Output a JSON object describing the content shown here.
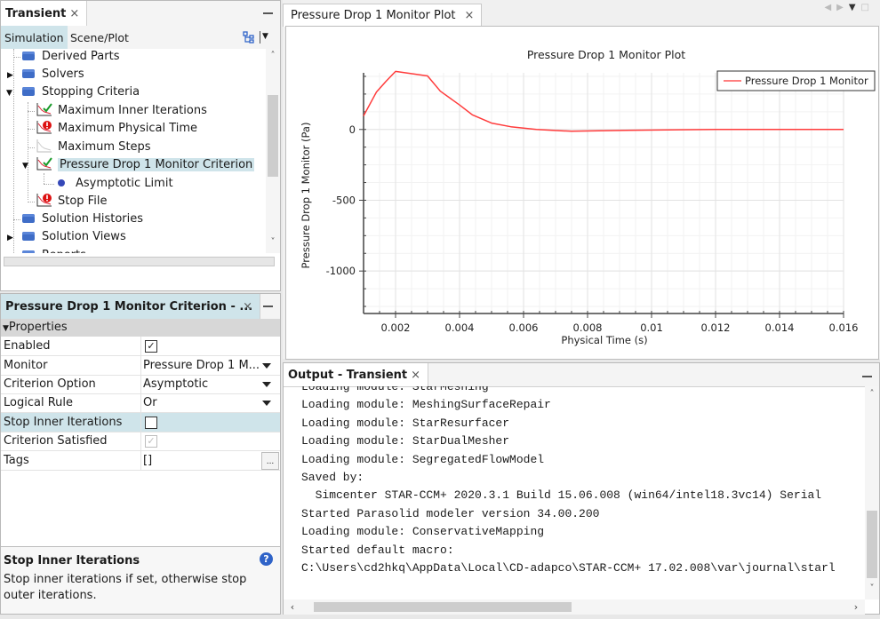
{
  "tree_panel": {
    "tab_label": "Transient",
    "subtabs": [
      "Simulation",
      "Scene/Plot"
    ],
    "items": [
      {
        "label": "Derived Parts",
        "icon": "folder-icon",
        "expander": ""
      },
      {
        "label": "Solvers",
        "icon": "folder-icon",
        "expander": "collapsed"
      },
      {
        "label": "Stopping Criteria",
        "icon": "folder-icon",
        "expander": "expanded"
      },
      {
        "label": "Maximum Inner Iterations",
        "icon": "criterion-satisfied-icon"
      },
      {
        "label": "Maximum Physical Time",
        "icon": "criterion-error-icon"
      },
      {
        "label": "Maximum Steps",
        "icon": "criterion-disabled-icon"
      },
      {
        "label": "Pressure Drop 1 Monitor Criterion",
        "icon": "criterion-satisfied-icon",
        "expander": "expanded",
        "selected": true
      },
      {
        "label": "Asymptotic Limit",
        "icon": "dot-icon"
      },
      {
        "label": "Stop File",
        "icon": "criterion-error-icon"
      },
      {
        "label": "Solution Histories",
        "icon": "folder-icon"
      },
      {
        "label": "Solution Views",
        "icon": "folder-icon",
        "expander": "collapsed"
      },
      {
        "label": "Reports",
        "icon": "folder-icon"
      }
    ]
  },
  "prop_panel": {
    "tab_label": "Pressure Drop 1 Monitor Criterion - ...",
    "section": "Properties",
    "rows": [
      {
        "name": "Enabled",
        "value": "",
        "type": "checkbox",
        "checked": true
      },
      {
        "name": "Monitor",
        "value": "Pressure Drop 1 M...",
        "type": "dropdown"
      },
      {
        "name": "Criterion Option",
        "value": "Asymptotic",
        "type": "dropdown"
      },
      {
        "name": "Logical Rule",
        "value": "Or",
        "type": "dropdown"
      },
      {
        "name": "Stop Inner Iterations",
        "value": "",
        "type": "checkbox",
        "checked": false,
        "highlight": true
      },
      {
        "name": "Criterion Satisfied",
        "value": "",
        "type": "checkbox",
        "checked": true,
        "disabled": true
      },
      {
        "name": "Tags",
        "value": "[]",
        "type": "ellipsis"
      }
    ],
    "help_title": "Stop Inner Iterations",
    "help_text": "Stop inner iterations if set, otherwise stop outer iterations.",
    "ellipsis_label": "..."
  },
  "plot_panel": {
    "tab_label": "Pressure Drop 1 Monitor Plot"
  },
  "chart_data": {
    "type": "line",
    "title": "Pressure Drop 1 Monitor Plot",
    "xlabel": "Physical Time (s)",
    "ylabel": "Pressure Drop 1 Monitor (Pa)",
    "xlim": [
      0.001,
      0.016
    ],
    "ylim": [
      -1300,
      400
    ],
    "xticks": [
      0.002,
      0.004,
      0.006,
      0.008,
      0.01,
      0.012,
      0.014,
      0.016
    ],
    "xtick_labels": [
      "0.002",
      "0.004",
      "0.006",
      "0.008",
      "0.01",
      "0.012",
      "0.014",
      "0.016"
    ],
    "yticks": [
      0,
      -500,
      -1000
    ],
    "ytick_labels": [
      "0",
      "-500",
      "-1000"
    ],
    "grid": true,
    "legend_position": "top-right",
    "series": [
      {
        "name": "Pressure Drop 1 Monitor",
        "color": "#ff3b3b",
        "x": [
          0.001,
          0.0014,
          0.0017,
          0.002,
          0.003,
          0.0034,
          0.004,
          0.0044,
          0.005,
          0.0056,
          0.0064,
          0.0075,
          0.0092,
          0.012,
          0.016
        ],
        "y": [
          96,
          263,
          340,
          410,
          378,
          270,
          173,
          103,
          45,
          19,
          0,
          -13,
          -6,
          0,
          0
        ]
      }
    ]
  },
  "output_panel": {
    "tab_label": "Output - Transient",
    "lines": [
      "Loading module: StarMeshing",
      "Loading module: MeshingSurfaceRepair",
      "Loading module: StarResurfacer",
      "Loading module: StarDualMesher",
      "Loading module: SegregatedFlowModel",
      "Saved by:",
      "  Simcenter STAR-CCM+ 2020.3.1 Build 15.06.008 (win64/intel18.3vc14) Serial",
      "Started Parasolid modeler version 34.00.200",
      "Loading module: ConservativeMapping",
      "Started default macro:",
      "C:\\Users\\cd2hkq\\AppData\\Local\\CD-adapco\\STAR-CCM+ 17.02.008\\var\\journal\\starl"
    ]
  },
  "glyphs": {
    "close": "×",
    "left": "‹",
    "right": "›",
    "up": "˄",
    "down": "˅",
    "check": "✓",
    "help": "?",
    "tri_down": "▼",
    "tri_right": "▶"
  }
}
